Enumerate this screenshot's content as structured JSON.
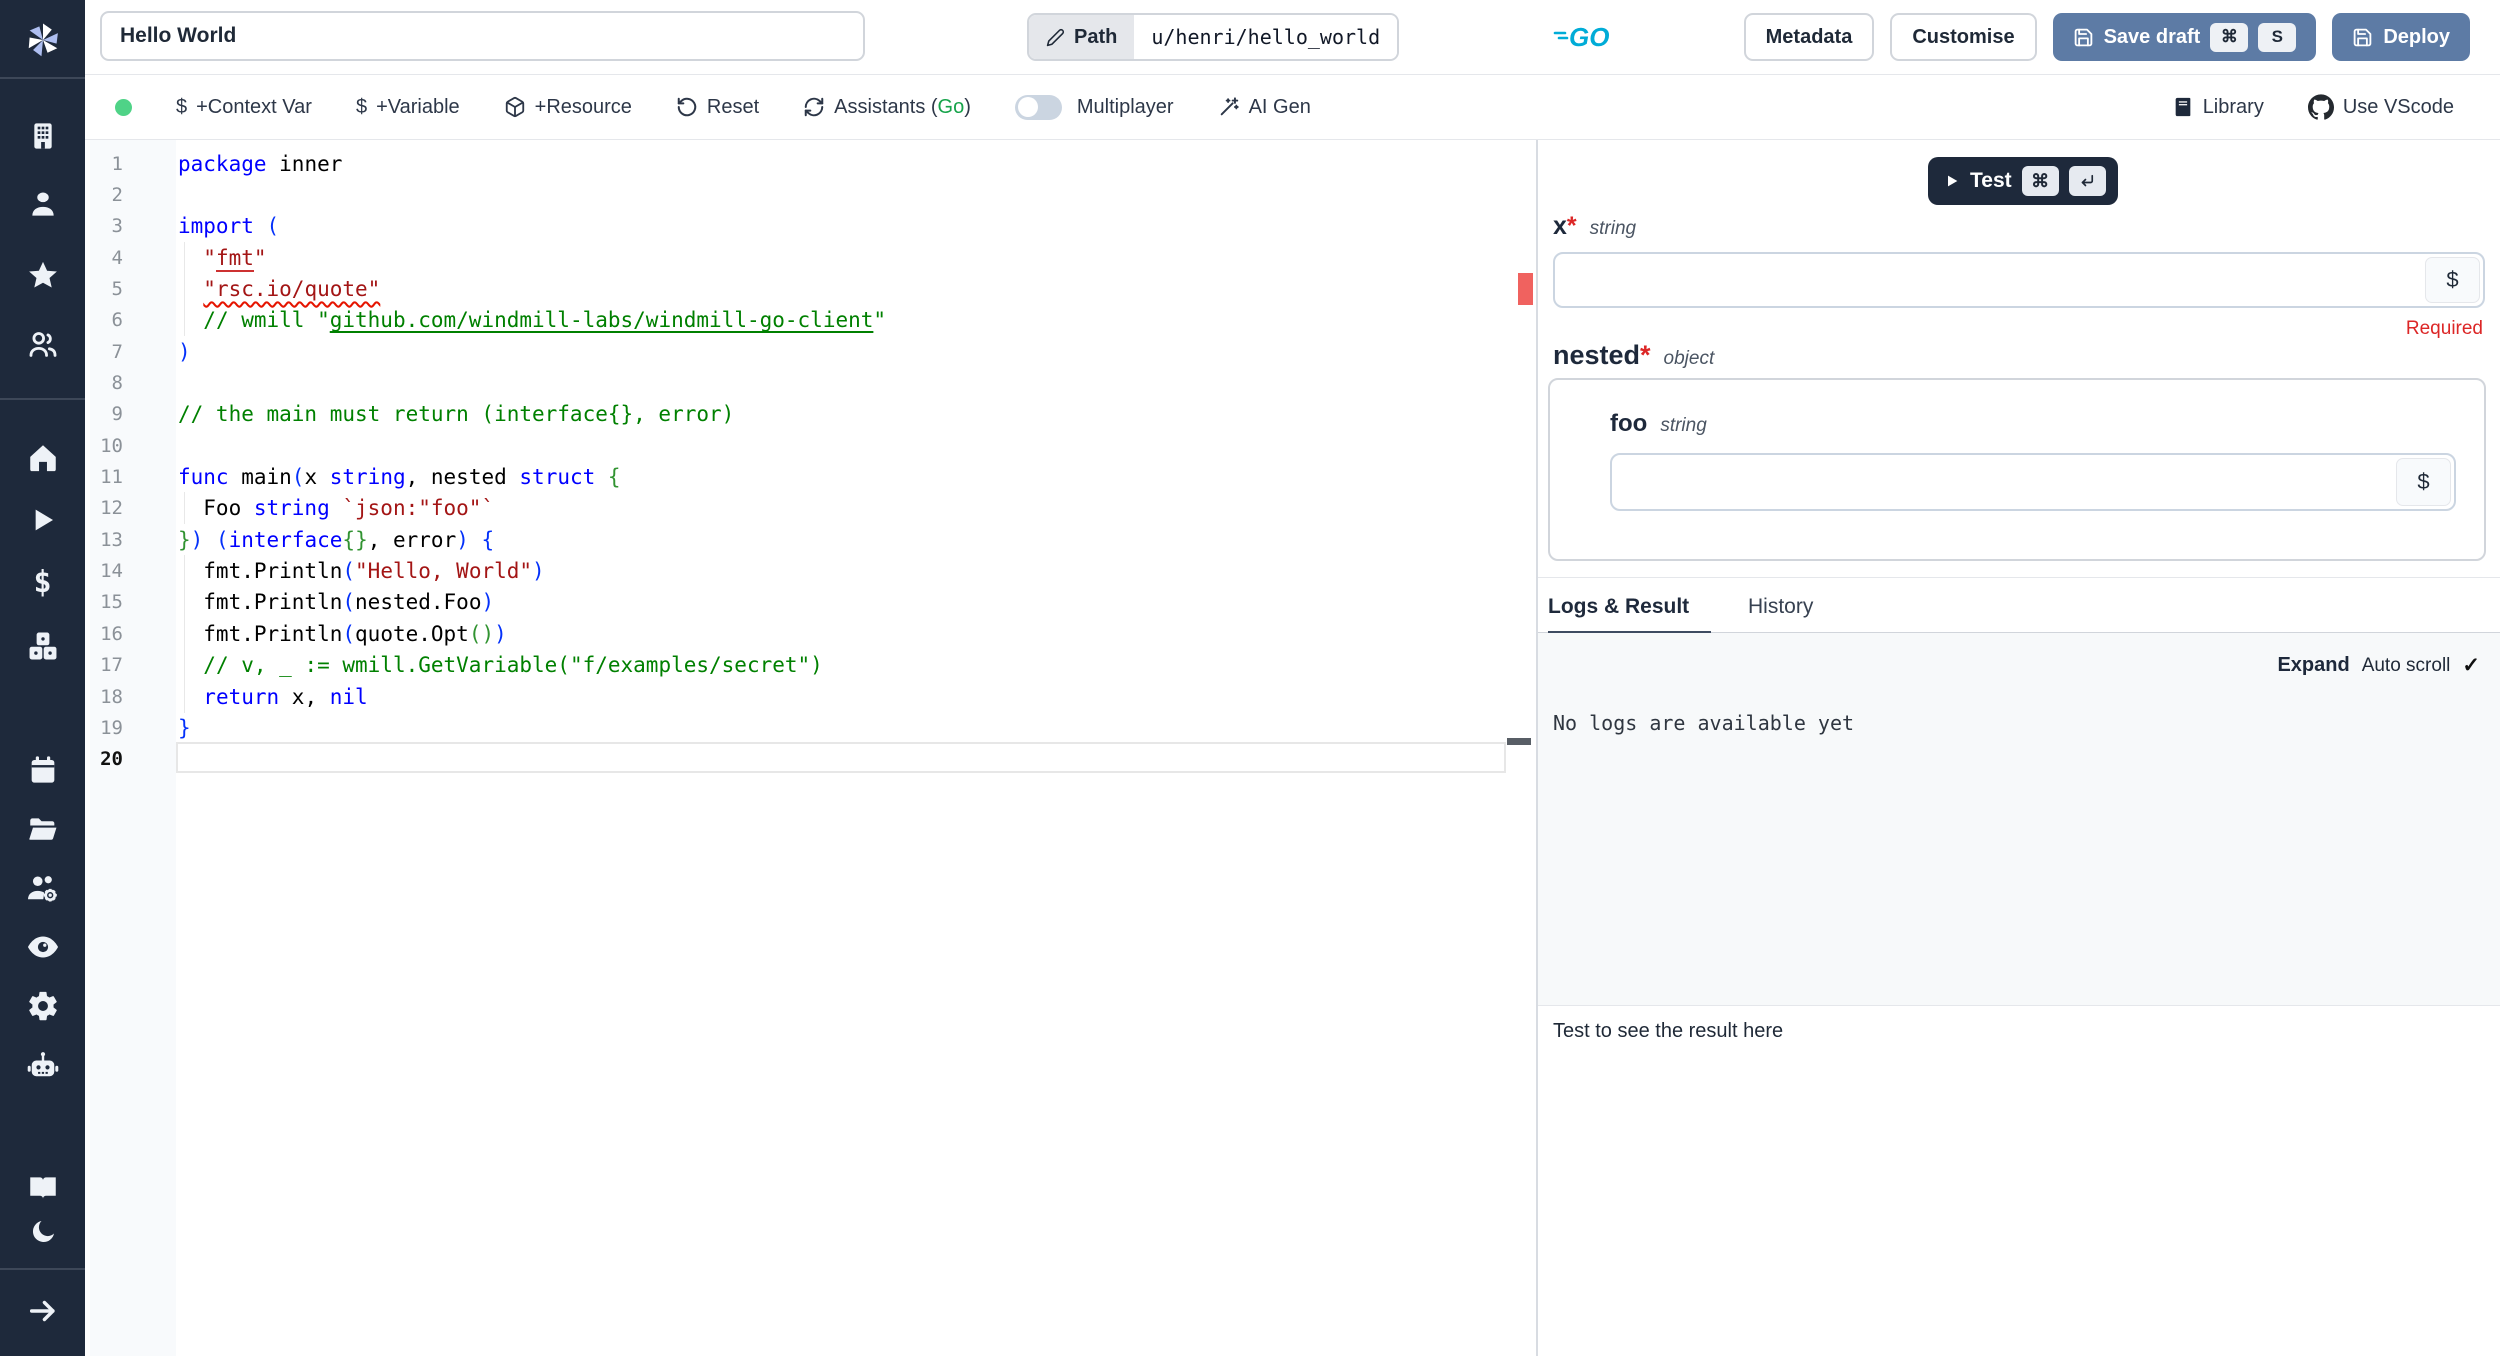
{
  "colors": {
    "sidebar": "#1e293b",
    "accent_blue": "#5d7ba5",
    "go_cyan": "#00acd7",
    "status_green": "#4fd387",
    "error_red": "#dc2626"
  },
  "topbar": {
    "title_value": "Hello World",
    "path_button": "Path",
    "path_value": "u/henri/hello_world",
    "language": "GO",
    "metadata": "Metadata",
    "customise": "Customise",
    "save_draft": "Save draft",
    "save_shortcut_mod": "⌘",
    "save_shortcut_key": "S",
    "deploy": "Deploy"
  },
  "toolbar": {
    "dollar": "$",
    "context_var": "+Context Var",
    "variable": "+Variable",
    "resource": "+Resource",
    "reset": "Reset",
    "assistants_prefix": "Assistants (",
    "assistants_lang": "Go",
    "assistants_suffix": ")",
    "multiplayer": "Multiplayer",
    "ai_gen": "AI Gen",
    "library": "Library",
    "use_vscode": "Use VScode"
  },
  "sidebar": {
    "items": [
      "windmill-logo",
      "building-icon",
      "user-icon",
      "star-icon",
      "users-icon",
      "home-icon",
      "play-icon",
      "dollar-icon",
      "boxes-icon",
      "calendar-icon",
      "folder-open-icon",
      "users-cog-icon",
      "eye-icon",
      "gear-icon",
      "bot-icon",
      "book-open-icon",
      "moon-icon",
      "arrow-right-icon"
    ]
  },
  "editor": {
    "active_line": 20,
    "lines": [
      {
        "n": 1,
        "ind": false,
        "seg": [
          {
            "c": "kw",
            "t": "package"
          },
          {
            "c": "pl",
            "t": " inner"
          }
        ]
      },
      {
        "n": 2,
        "ind": false,
        "seg": []
      },
      {
        "n": 3,
        "ind": false,
        "seg": [
          {
            "c": "kw",
            "t": "import"
          },
          {
            "c": "pl",
            "t": " "
          },
          {
            "c": "b0",
            "t": "("
          }
        ]
      },
      {
        "n": 4,
        "ind": true,
        "seg": [
          {
            "c": "pl",
            "t": "  "
          },
          {
            "c": "str",
            "t": "\""
          },
          {
            "c": "str us",
            "t": "fmt"
          },
          {
            "c": "str",
            "t": "\""
          }
        ]
      },
      {
        "n": 5,
        "ind": true,
        "seg": [
          {
            "c": "pl",
            "t": "  "
          },
          {
            "c": "str uw",
            "t": "\"rsc.io/quote\""
          }
        ]
      },
      {
        "n": 6,
        "ind": true,
        "seg": [
          {
            "c": "pl",
            "t": "  "
          },
          {
            "c": "com",
            "t": "// wmill \""
          },
          {
            "c": "com lk",
            "t": "github.com/windmill-labs/windmill-go-client"
          },
          {
            "c": "com",
            "t": "\""
          }
        ]
      },
      {
        "n": 7,
        "ind": false,
        "seg": [
          {
            "c": "b0",
            "t": ")"
          }
        ]
      },
      {
        "n": 8,
        "ind": false,
        "seg": []
      },
      {
        "n": 9,
        "ind": false,
        "seg": [
          {
            "c": "com",
            "t": "// the main must return (interface{}, error)"
          }
        ]
      },
      {
        "n": 10,
        "ind": false,
        "seg": []
      },
      {
        "n": 11,
        "ind": false,
        "seg": [
          {
            "c": "kw",
            "t": "func"
          },
          {
            "c": "pl",
            "t": " main"
          },
          {
            "c": "b0",
            "t": "("
          },
          {
            "c": "pl",
            "t": "x "
          },
          {
            "c": "kw",
            "t": "string"
          },
          {
            "c": "pl",
            "t": ", nested "
          },
          {
            "c": "kw",
            "t": "struct"
          },
          {
            "c": "pl",
            "t": " "
          },
          {
            "c": "b1",
            "t": "{"
          }
        ]
      },
      {
        "n": 12,
        "ind": true,
        "seg": [
          {
            "c": "pl",
            "t": "  Foo "
          },
          {
            "c": "kw",
            "t": "string"
          },
          {
            "c": "pl",
            "t": " "
          },
          {
            "c": "str",
            "t": "`json:\"foo\"`"
          }
        ]
      },
      {
        "n": 13,
        "ind": false,
        "seg": [
          {
            "c": "b1",
            "t": "}"
          },
          {
            "c": "b0",
            "t": ")"
          },
          {
            "c": "pl",
            "t": " "
          },
          {
            "c": "b0",
            "t": "("
          },
          {
            "c": "kw",
            "t": "interface"
          },
          {
            "c": "b1",
            "t": "{}"
          },
          {
            "c": "pl",
            "t": ", error"
          },
          {
            "c": "b0",
            "t": ")"
          },
          {
            "c": "pl",
            "t": " "
          },
          {
            "c": "b0",
            "t": "{"
          }
        ]
      },
      {
        "n": 14,
        "ind": true,
        "seg": [
          {
            "c": "pl",
            "t": "  fmt.Println"
          },
          {
            "c": "b0",
            "t": "("
          },
          {
            "c": "str",
            "t": "\"Hello, World\""
          },
          {
            "c": "b0",
            "t": ")"
          }
        ]
      },
      {
        "n": 15,
        "ind": true,
        "seg": [
          {
            "c": "pl",
            "t": "  fmt.Println"
          },
          {
            "c": "b0",
            "t": "("
          },
          {
            "c": "pl",
            "t": "nested.Foo"
          },
          {
            "c": "b0",
            "t": ")"
          }
        ]
      },
      {
        "n": 16,
        "ind": true,
        "seg": [
          {
            "c": "pl",
            "t": "  fmt.Println"
          },
          {
            "c": "b0",
            "t": "("
          },
          {
            "c": "pl",
            "t": "quote.Opt"
          },
          {
            "c": "b1",
            "t": "()"
          },
          {
            "c": "b0",
            "t": ")"
          }
        ]
      },
      {
        "n": 17,
        "ind": true,
        "seg": [
          {
            "c": "pl",
            "t": "  "
          },
          {
            "c": "com",
            "t": "// v, _ := wmill.GetVariable(\"f/examples/secret\")"
          }
        ]
      },
      {
        "n": 18,
        "ind": true,
        "seg": [
          {
            "c": "pl",
            "t": "  "
          },
          {
            "c": "kw",
            "t": "return"
          },
          {
            "c": "pl",
            "t": " x, "
          },
          {
            "c": "kw",
            "t": "nil"
          }
        ]
      },
      {
        "n": 19,
        "ind": false,
        "seg": [
          {
            "c": "b0",
            "t": "}"
          }
        ]
      },
      {
        "n": 20,
        "ind": false,
        "seg": []
      }
    ]
  },
  "panel": {
    "test": "Test",
    "test_shortcut_mod": "⌘",
    "dollar": "$",
    "arg_x_name": "x",
    "arg_x_star": "*",
    "arg_x_type": "string",
    "arg_x_error": "Required",
    "arg_nested_name": "nested",
    "arg_nested_star": "*",
    "arg_nested_type": "object",
    "arg_foo_name": "foo",
    "arg_foo_type": "string",
    "tab_logs": "Logs & Result",
    "tab_history": "History",
    "expand": "Expand",
    "auto_scroll": "Auto scroll",
    "check": "✓",
    "no_logs": "No logs are available yet",
    "result_placeholder": "Test to see the result here"
  }
}
